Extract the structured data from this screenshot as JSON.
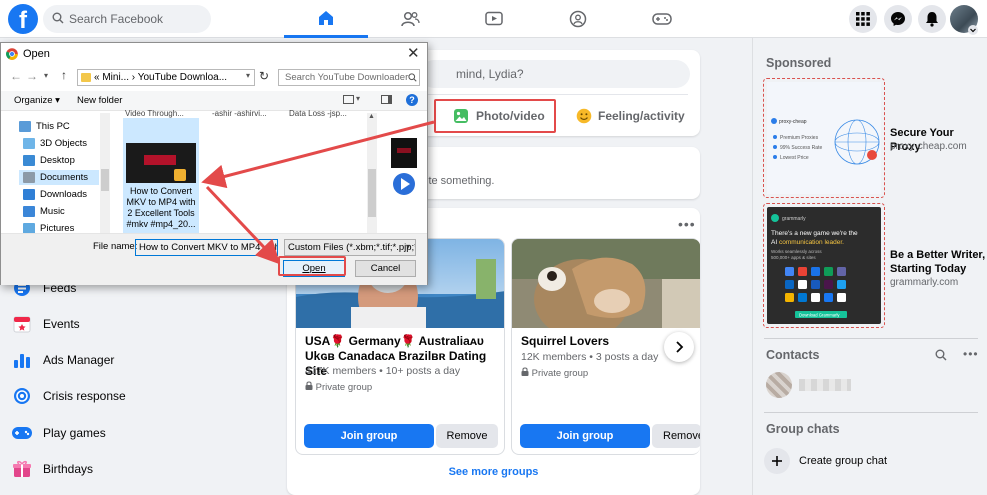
{
  "topbar": {
    "logo_letter": "f",
    "search_placeholder": "Search Facebook",
    "nav_icons": [
      "home-icon",
      "friends-icon",
      "watch-icon",
      "groups-icon",
      "gaming-icon"
    ],
    "right_icons": [
      "menu-grid-icon",
      "messenger-icon",
      "notifications-icon",
      "account-avatar"
    ]
  },
  "sidebar": {
    "items": [
      {
        "label": "Feeds",
        "icon": "feeds-icon"
      },
      {
        "label": "Events",
        "icon": "calendar-icon"
      },
      {
        "label": "Ads Manager",
        "icon": "bar-chart-icon"
      },
      {
        "label": "Crisis response",
        "icon": "crisis-icon"
      },
      {
        "label": "Play games",
        "icon": "gamepad-icon"
      },
      {
        "label": "Birthdays",
        "icon": "gift-icon"
      }
    ]
  },
  "composer": {
    "placeholder": "mind, Lydia?",
    "photo_video": "Photo/video",
    "feeling": "Feeling/activity",
    "write_prompt": "ite something."
  },
  "groups": {
    "cards": [
      {
        "name": "USA🌹 Germany🌹 Australiaᴀᴜ Ukɢʙ Canadaᴄᴀ Brazilʙʀ Dating Site",
        "members": "417K members • 10+ posts a day",
        "privacy": "Private group",
        "join": "Join group",
        "remove": "Remove"
      },
      {
        "name": "Squirrel Lovers",
        "members": "12K members • 3 posts a day",
        "privacy": "Private group",
        "join": "Join group",
        "remove": "Remove"
      }
    ],
    "see_more": "See more groups"
  },
  "right": {
    "sponsored": "Sponsored",
    "ads": [
      {
        "title": "Secure Your Proxy",
        "url": "proxy-cheap.com",
        "logo": "proxy-cheap",
        "lines": [
          "Premium Proxies",
          "99% Success Rate",
          "Lowest Price"
        ]
      },
      {
        "title": "Be a Better Writer, Starting Today",
        "url": "grammarly.com",
        "logo": "grammarly",
        "headline": "There's a new game we're the AI communication leader.",
        "sub": "Works seamlessly across 500,000+ apps & sites",
        "cta": "Download Grammarly"
      }
    ],
    "contacts": "Contacts",
    "group_chats": "Group chats",
    "create_group_chat": "Create group chat"
  },
  "dialog": {
    "title": "Open",
    "close": "✕",
    "address": "«  Mini...  ›  YouTube Downloa...",
    "search_placeholder": "Search YouTube Downloader",
    "organize": "Organize ▾",
    "new_folder": "New folder",
    "help": "?",
    "tree": [
      "This PC",
      "3D Objects",
      "Desktop",
      "Documents",
      "Downloads",
      "Music",
      "Pictures"
    ],
    "top_captions": [
      "Video Through...",
      "-ashir -ashirvi...",
      "Data Loss -jsp..."
    ],
    "file_caption": "How to Convert MKV to MP4 with 2 Excellent Tools #mkv #mp4_20...",
    "file_name_label": "File name:",
    "file_name_value": "How to Convert MKV to MP4 with",
    "file_type": "Custom Files (*.xbm;*.tif;*.pjp;*",
    "open_btn": "Open",
    "cancel_btn": "Cancel"
  },
  "colors": {
    "fb_blue": "#1877f2",
    "annotation_red": "#e34a4a"
  }
}
